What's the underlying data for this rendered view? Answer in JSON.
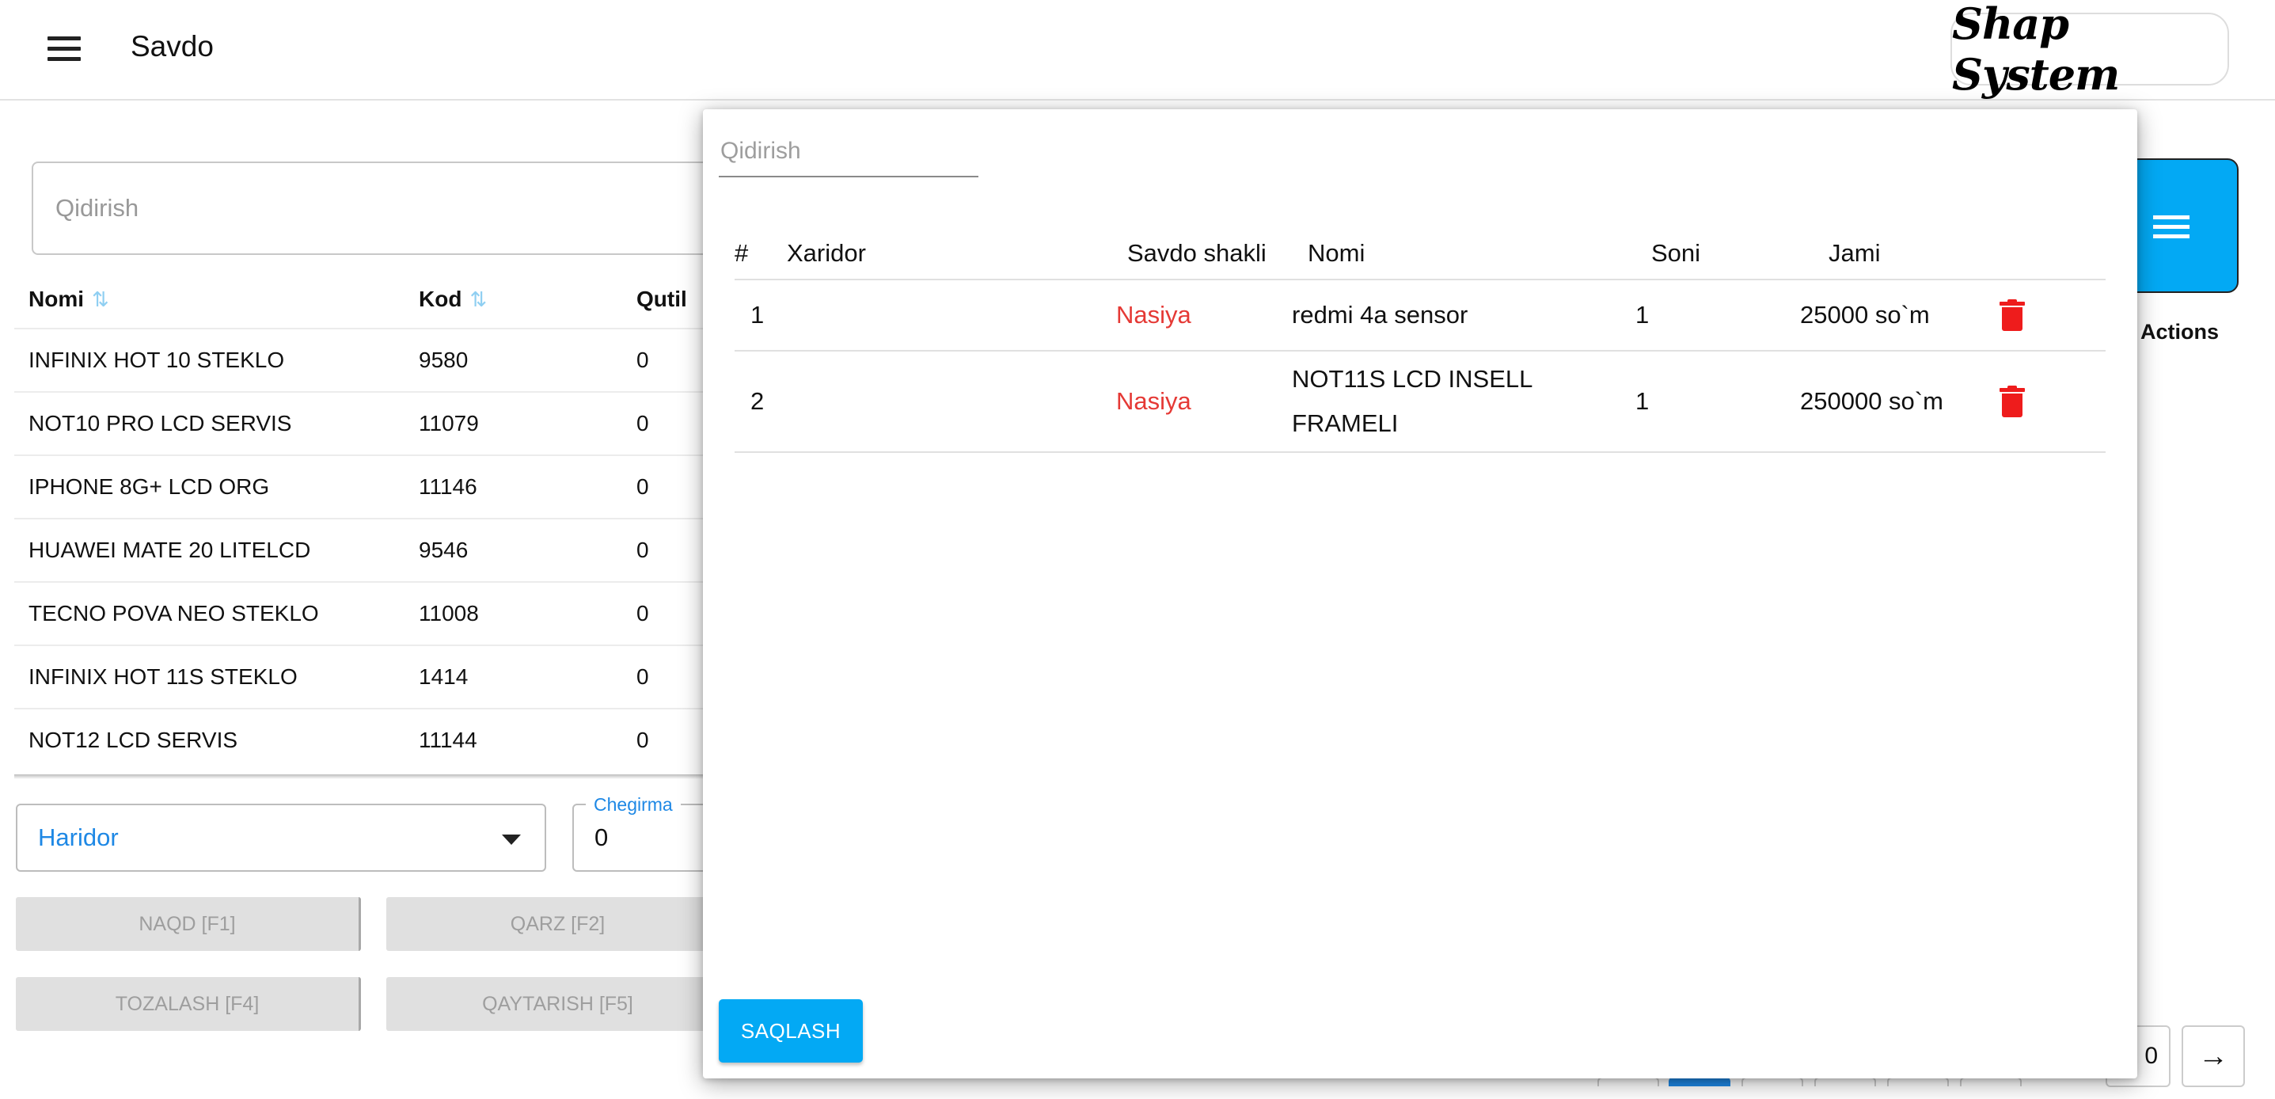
{
  "header": {
    "title": "Savdo",
    "logo_text": "Shap System"
  },
  "background": {
    "search_placeholder": "Qidirish",
    "table": {
      "columns": [
        "Nomi",
        "Kod",
        "Qutil"
      ],
      "rows": [
        {
          "name": "INFINIX HOT 10 STEKLO",
          "code": "9580",
          "qty": "0"
        },
        {
          "name": "NOT10 PRO LCD SERVIS",
          "code": "11079",
          "qty": "0"
        },
        {
          "name": "IPHONE 8G+ LCD ORG",
          "code": "11146",
          "qty": "0"
        },
        {
          "name": "HUAWEI MATE 20 LITELCD",
          "code": "9546",
          "qty": "0"
        },
        {
          "name": "TECNO POVA NEO STEKLO",
          "code": "11008",
          "qty": "0"
        },
        {
          "name": "INFINIX HOT 11S STEKLO",
          "code": "1414",
          "qty": "0"
        },
        {
          "name": "NOT12 LCD SERVIS",
          "code": "11144",
          "qty": "0"
        }
      ]
    },
    "customer_select": {
      "value": "Haridor"
    },
    "discount": {
      "label": "Chegirma",
      "value": "0"
    },
    "buttons": {
      "cash": "NAQD [F1]",
      "debt": "QARZ [F2]",
      "clear": "TOZALASH [F4]",
      "return": "QAYTARISH [F5]"
    },
    "actions_label": "Actions",
    "page_number": "0",
    "next_icon": "arrow-right-icon",
    "list_icon": "list-icon"
  },
  "modal": {
    "search_placeholder": "Qidirish",
    "table": {
      "columns": {
        "index": "#",
        "customer": "Xaridor",
        "sale_type": "Savdo shakli",
        "name": "Nomi",
        "qty": "Soni",
        "total": "Jami"
      },
      "rows": [
        {
          "index": "1",
          "customer": "",
          "sale_type": "Nasiya",
          "name": "redmi 4a sensor",
          "qty": "1",
          "total": "25000 so`m"
        },
        {
          "index": "2",
          "customer": "",
          "sale_type": "Nasiya",
          "name": "NOT11S LCD INSELL FRAMELI",
          "qty": "1",
          "total": "250000 so`m"
        }
      ]
    },
    "save_button": "SAQLASH",
    "colors": {
      "accent": "#03a9f4",
      "nasiya": "#e53935",
      "delete": "#ee1c1c"
    }
  }
}
